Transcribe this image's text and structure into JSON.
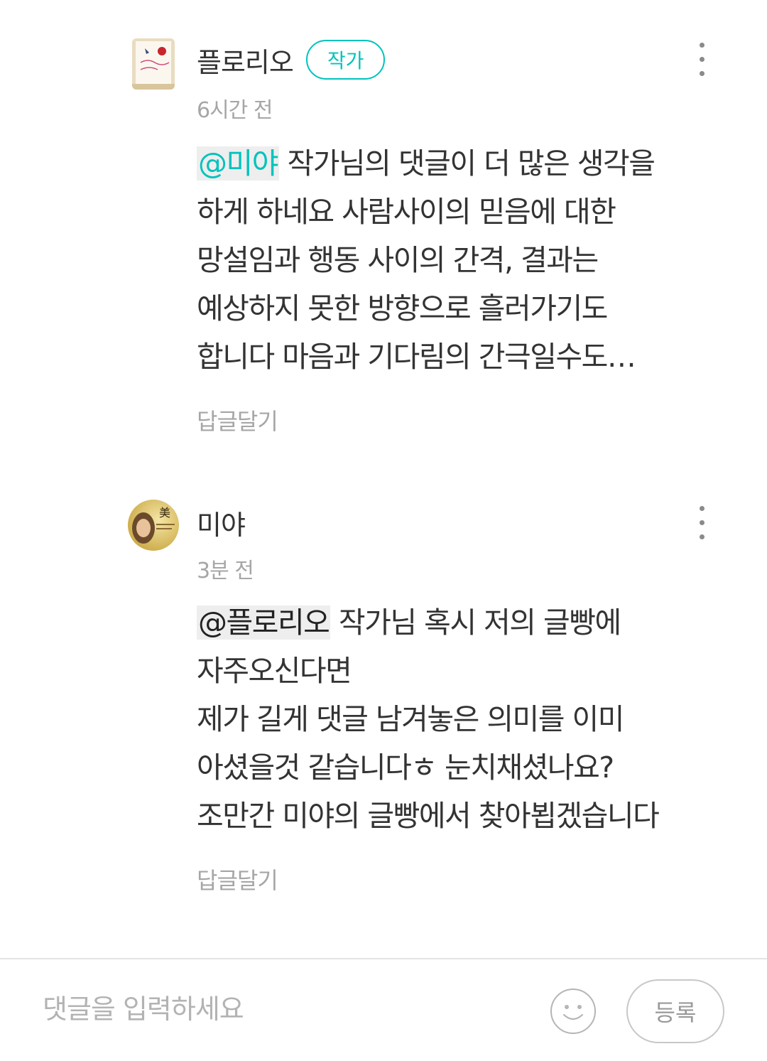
{
  "comments": [
    {
      "author": "플로리오",
      "badge": "작가",
      "time": "6시간 전",
      "mention": "@미야",
      "lines": [
        " 작가님의 댓글이 더 많은 생각을",
        "하게 하네요 사람사이의 믿음에 대한",
        "망설임과 행동 사이의 간격, 결과는",
        "예상하지 못한 방향으로 흘러가기도",
        "합니다  마음과 기다림의 간극일수도…"
      ],
      "reply_label": "답글달기"
    },
    {
      "author": "미야",
      "time": "3분 전",
      "mention": "@플로리오",
      "lines": [
        " 작가님 혹시 저의 글빵에",
        "자주오신다면",
        "제가 길게 댓글 남겨놓은  의미를 이미",
        "아셨을것 같습니다ㅎ 눈치채셨나요?",
        "조만간 미야의 글빵에서 찾아뵙겠습니다"
      ],
      "reply_label": "답글달기"
    }
  ],
  "input": {
    "placeholder": "댓글을 입력하세요",
    "emoji_icon": "smile-emoji-icon",
    "submit_label": "등록"
  },
  "colors": {
    "accent": "#00c3bd",
    "muted_text": "#a6a6a6",
    "body_text": "#333333",
    "mention_bg": "#eeeeee"
  }
}
